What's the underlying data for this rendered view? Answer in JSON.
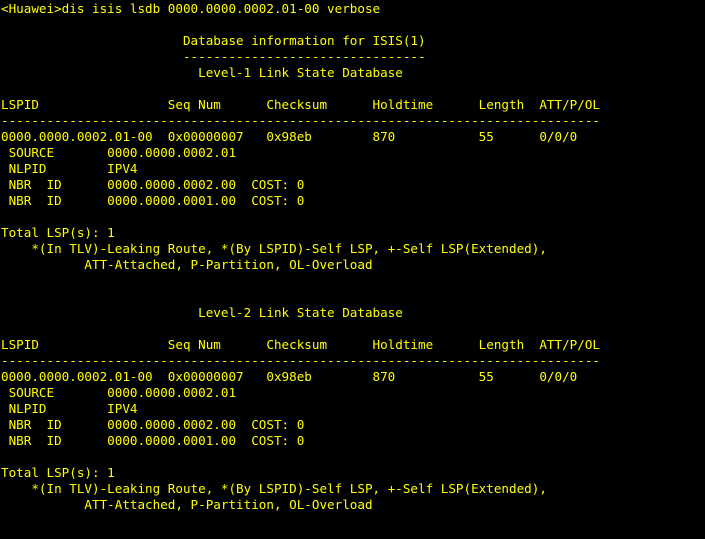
{
  "terminal": {
    "text_color": "#ffff00",
    "background_color": "#000000",
    "lines": [
      "<Huawei>dis isis lsdb 0000.0000.0002.01-00 verbose",
      "",
      "                        Database information for ISIS(1)",
      "                        --------------------------------",
      "                          Level-1 Link State Database",
      "",
      "LSPID                 Seq Num      Checksum      Holdtime      Length  ATT/P/OL",
      "-------------------------------------------------------------------------------",
      "0000.0000.0002.01-00  0x00000007   0x98eb        870           55      0/0/0",
      " SOURCE       0000.0000.0002.01",
      " NLPID        IPV4",
      " NBR  ID      0000.0000.0002.00  COST: 0",
      " NBR  ID      0000.0000.0001.00  COST: 0",
      "",
      "Total LSP(s): 1",
      "    *(In TLV)-Leaking Route, *(By LSPID)-Self LSP, +-Self LSP(Extended),",
      "           ATT-Attached, P-Partition, OL-Overload",
      "",
      "",
      "                          Level-2 Link State Database",
      "",
      "LSPID                 Seq Num      Checksum      Holdtime      Length  ATT/P/OL",
      "-------------------------------------------------------------------------------",
      "0000.0000.0002.01-00  0x00000007   0x98eb        870           55      0/0/0",
      " SOURCE       0000.0000.0002.01",
      " NLPID        IPV4",
      " NBR  ID      0000.0000.0002.00  COST: 0",
      " NBR  ID      0000.0000.0001.00  COST: 0",
      "",
      "Total LSP(s): 1",
      "    *(In TLV)-Leaking Route, *(By LSPID)-Self LSP, +-Self LSP(Extended),",
      "           ATT-Attached, P-Partition, OL-Overload",
      ""
    ]
  }
}
